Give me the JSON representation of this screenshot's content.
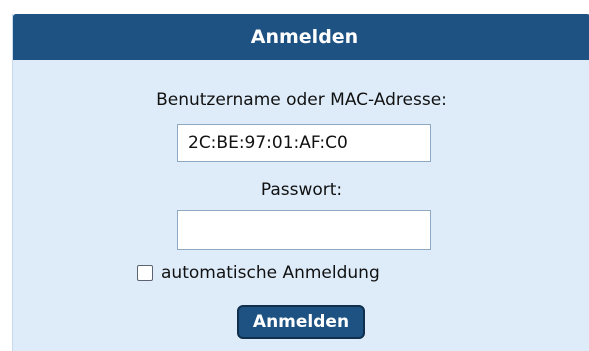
{
  "login_form": {
    "title": "Anmelden",
    "username_label": "Benutzername oder MAC-Adresse:",
    "username_value": "2C:BE:97:01:AF:C0",
    "password_label": "Passwort:",
    "password_value": "",
    "remember_label": "automatische Anmeldung",
    "remember_checked": false,
    "submit_label": "Anmelden"
  },
  "colors": {
    "header_bg": "#1d5283",
    "panel_bg": "#deecf9",
    "button_bg": "#1d5283"
  }
}
